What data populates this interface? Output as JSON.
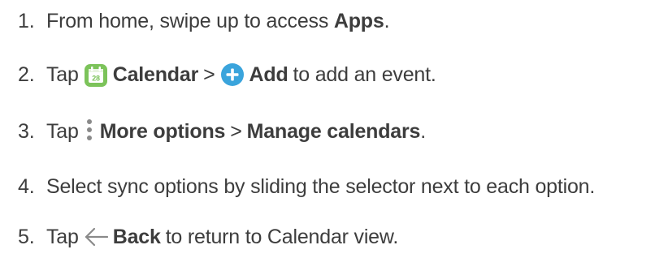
{
  "steps": [
    {
      "number": "1.",
      "text_before": "From home, swipe up to access ",
      "bold": "Apps",
      "text_after": "."
    },
    {
      "number": "2.",
      "tap": "Tap",
      "icon1": "calendar-app-icon",
      "bold1": "Calendar",
      "sep": ">",
      "icon2": "add-icon",
      "bold2": "Add",
      "text_after": "to add an event."
    },
    {
      "number": "3.",
      "tap": "Tap",
      "icon1": "more-options-icon",
      "bold1": "More options",
      "sep": ">",
      "bold2": "Manage calendars",
      "text_after": "."
    },
    {
      "number": "4.",
      "text": "Select sync options by sliding the selector next to each option."
    },
    {
      "number": "5.",
      "tap": "Tap",
      "icon1": "back-arrow-icon",
      "bold1": "Back",
      "text_after": "to return to Calendar view."
    }
  ],
  "colors": {
    "text": "#3d3d3d",
    "calendar_icon": "#7cc35a",
    "add_icon": "#3aa4dc",
    "more_icon": "#8a8a8a",
    "back_icon": "#8a8a8a"
  }
}
